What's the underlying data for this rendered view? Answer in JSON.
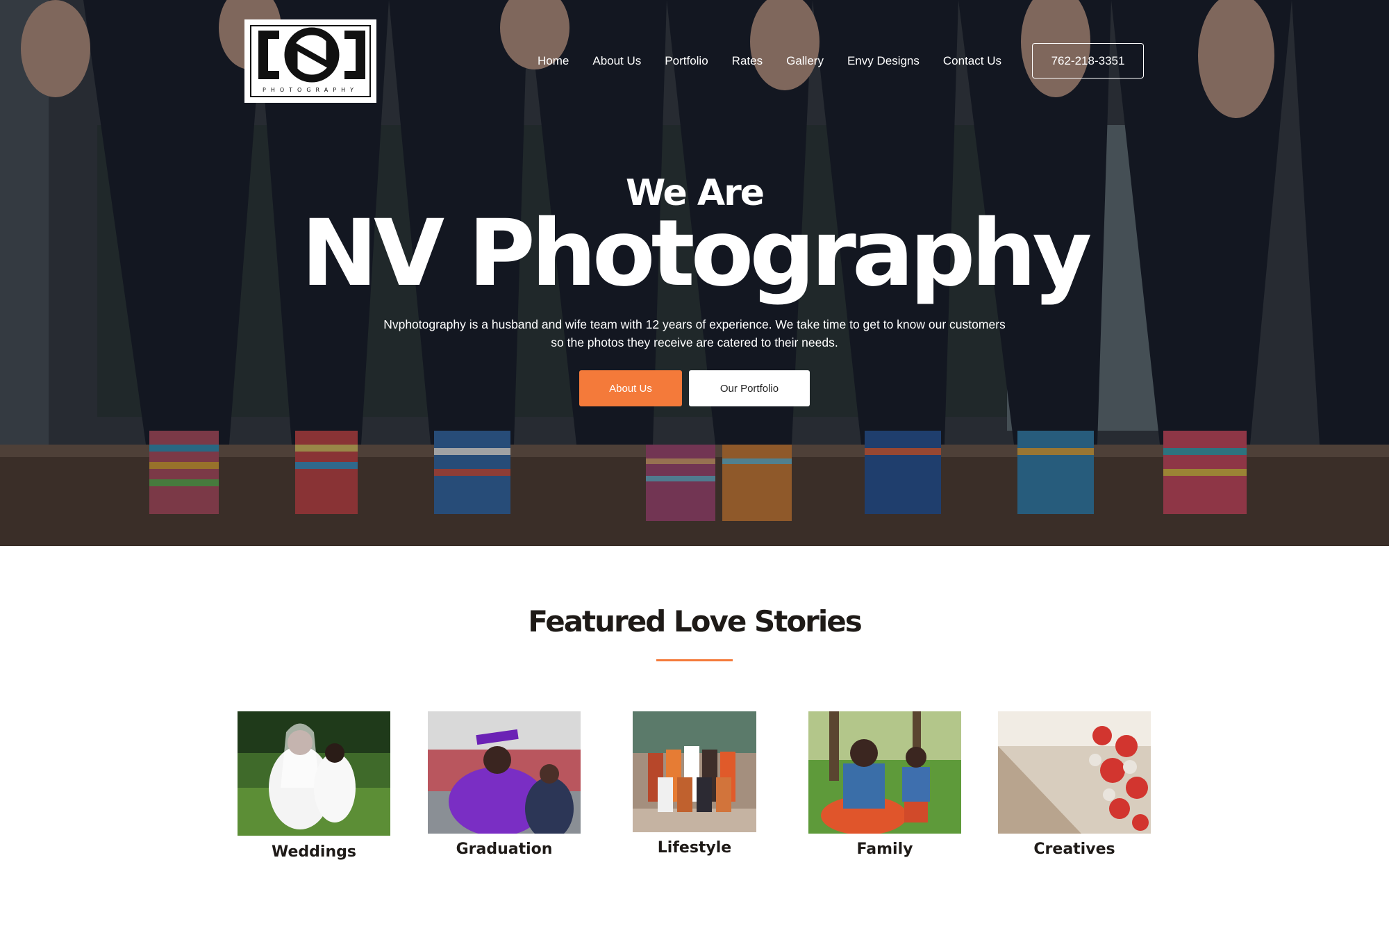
{
  "header": {
    "logo_text": "PHOTOGRAPHY",
    "nav": [
      "Home",
      "About Us",
      "Portfolio",
      "Rates",
      "Gallery",
      "Envy Designs",
      "Contact Us"
    ],
    "phone": "762-218-3351"
  },
  "hero": {
    "eyebrow": "We Are",
    "title": "NV Photography",
    "intro": "Nvphotography is a husband and wife team with 12 years of experience. We take time to get to know our customers so the photos they receive are catered to their needs.",
    "cta_primary": "About Us",
    "cta_secondary": "Our Portfolio",
    "accent_color": "#f47a3a"
  },
  "featured": {
    "title": "Featured Love Stories",
    "categories": [
      {
        "label": "Weddings"
      },
      {
        "label": "Graduation"
      },
      {
        "label": "Lifestyle"
      },
      {
        "label": "Family"
      },
      {
        "label": "Creatives"
      }
    ]
  }
}
